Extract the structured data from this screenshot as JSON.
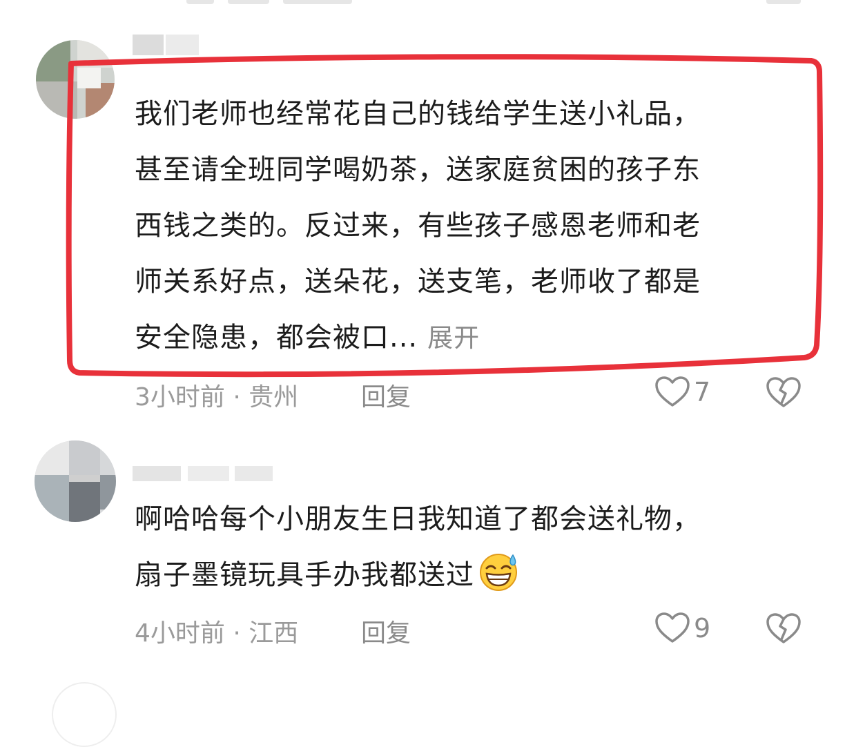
{
  "comments": [
    {
      "lines": [
        "我们老师也经常花自己的钱给学生送小礼品，",
        "甚至请全班同学喝奶茶，送家庭贫困的孩子东",
        "西钱之类的。反过来，有些孩子感恩老师和老",
        "师关系好点，送朵花，送支笔，老师收了都是",
        "安全隐患，都会被口..."
      ],
      "expand_label": "展开",
      "time_location": "3小时前 · 贵州",
      "reply_label": "回复",
      "like_count": "7",
      "highlighted": true
    },
    {
      "lines": [
        "啊哈哈每个小朋友生日我知道了都会送礼物，",
        "扇子墨镜玩具手办我都送过"
      ],
      "emoji": "grinning-sweat-emoji",
      "time_location": "4小时前 · 江西",
      "reply_label": "回复",
      "like_count": "9"
    }
  ],
  "colors": {
    "highlight_border": "#e8313a",
    "meta_text": "#9a9a9a",
    "body_text": "#1c1c1c"
  }
}
